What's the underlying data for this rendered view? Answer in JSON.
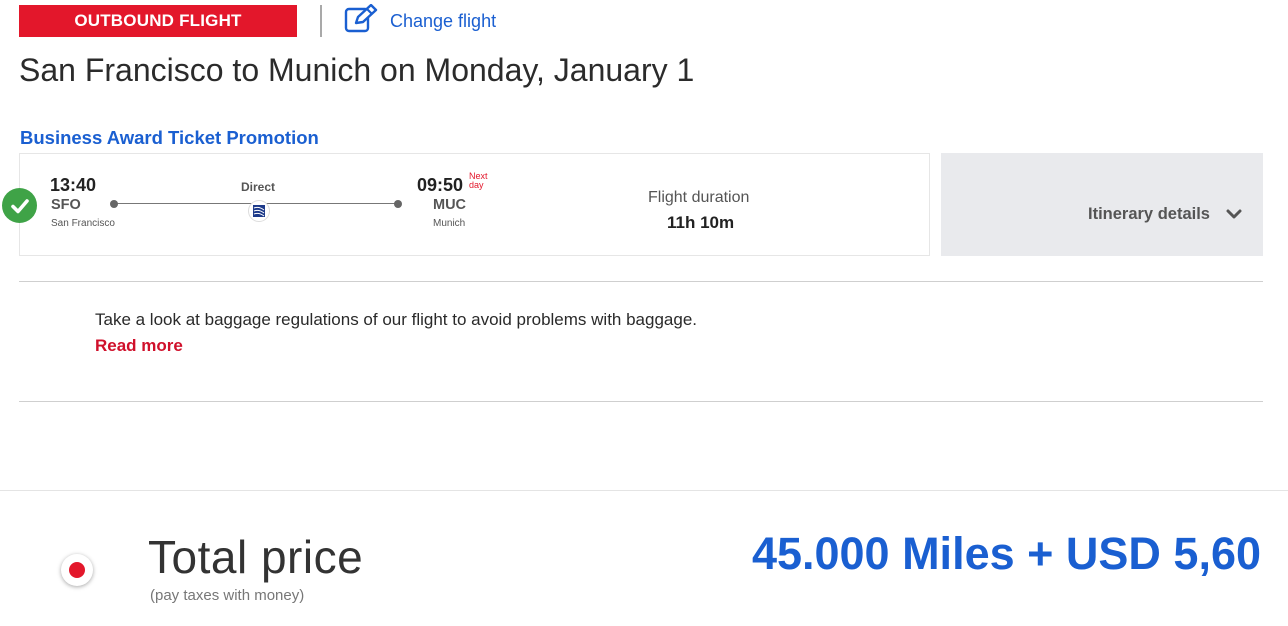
{
  "header": {
    "badge": "OUTBOUND FLIGHT",
    "change_flight": "Change flight",
    "change_icon": "edit-icon"
  },
  "title": "San Francisco to Munich on Monday, January 1",
  "promotion": "Business Award Ticket Promotion",
  "flight": {
    "selected_icon": "checkmark-icon",
    "departure": {
      "time": "13:40",
      "code": "SFO",
      "city": "San Francisco"
    },
    "stops": "Direct",
    "airline_icon": "airline-logo-icon",
    "arrival": {
      "time": "09:50",
      "next_day_1": "Next",
      "next_day_2": "day",
      "code": "MUC",
      "city": "Munich"
    },
    "duration_label": "Flight duration",
    "duration": "11h 10m"
  },
  "itinerary": {
    "label": "Itinerary details",
    "icon": "chevron-down-icon"
  },
  "baggage": {
    "text": "Take a look at baggage regulations of our flight to avoid problems with baggage.",
    "read_more": "Read more"
  },
  "total": {
    "label": "Total price",
    "sub": "(pay taxes with money)",
    "amount": "45.000 Miles + USD 5,60"
  },
  "colors": {
    "brand_red": "#e3172b",
    "link_blue": "#1a5fd1",
    "success_green": "#3fa347",
    "panel_gray": "#e9eaed"
  }
}
